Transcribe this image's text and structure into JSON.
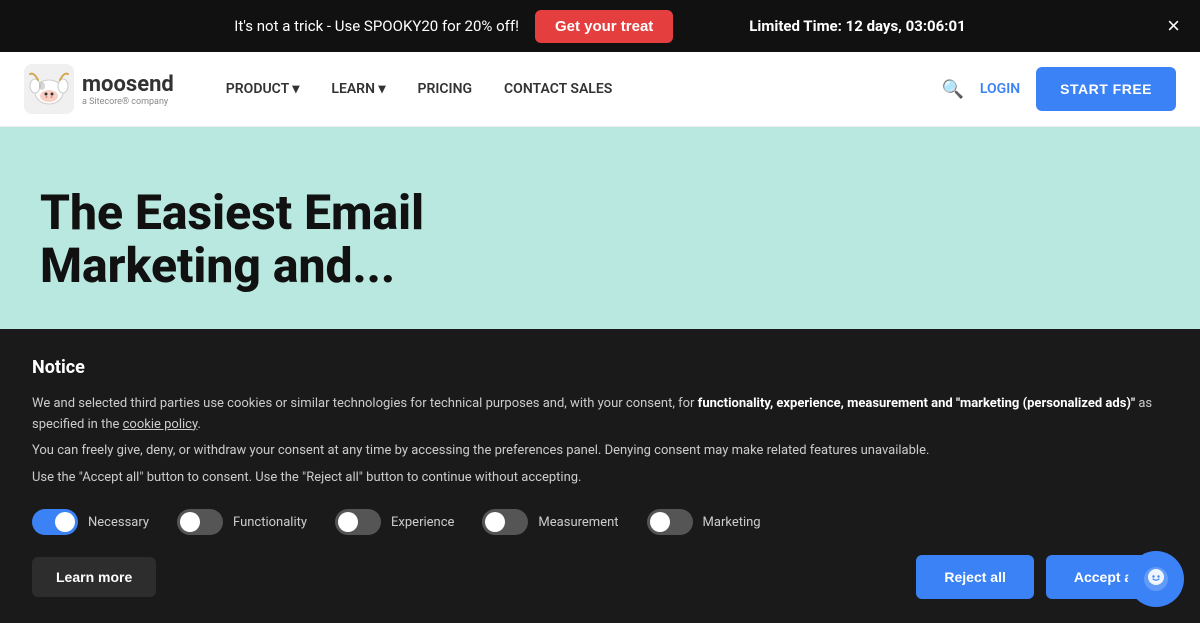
{
  "announcement": {
    "pre_text": "It's not a trick - Use SPOOKY20 for 20% off!",
    "cta_label": "Get your treat",
    "timer_label": "Limited Time:",
    "timer_value": "12 days, 03:06:01",
    "close_label": "×"
  },
  "navbar": {
    "logo_name": "moosend",
    "logo_sub": "a Sitecore® company",
    "product_label": "PRODUCT ▾",
    "learn_label": "LEARN ▾",
    "pricing_label": "PRICING",
    "contact_label": "CONTACT SALES",
    "login_label": "LOGIN",
    "start_free_label": "START FREE"
  },
  "hero": {
    "title_line1": "The Easiest Email",
    "title_line2": "Marketing and..."
  },
  "cookie": {
    "title": "Notice",
    "body1_normal": "We and selected third parties use cookies or similar technologies for technical purposes and, with your consent, for ",
    "body1_bold": "functionality, experience, measurement and \"marketing (personalized ads)\"",
    "body1_end": " as specified in the ",
    "cookie_policy_link": "cookie policy",
    "body1_period": ".",
    "body2": "You can freely give, deny, or withdraw your consent at any time by accessing the preferences panel. Denying consent may make related features unavailable.",
    "body3": "Use the \"Accept all\" button to consent. Use the \"Reject all\" button to continue without accepting.",
    "toggles": [
      {
        "id": "necessary",
        "label": "Necessary",
        "state": "on"
      },
      {
        "id": "functionality",
        "label": "Functionality",
        "state": "off"
      },
      {
        "id": "experience",
        "label": "Experience",
        "state": "off"
      },
      {
        "id": "measurement",
        "label": "Measurement",
        "state": "off"
      },
      {
        "id": "marketing",
        "label": "Marketing",
        "state": "off"
      }
    ],
    "learn_more_label": "Learn more",
    "reject_label": "Reject all",
    "accept_label": "Accept all"
  }
}
